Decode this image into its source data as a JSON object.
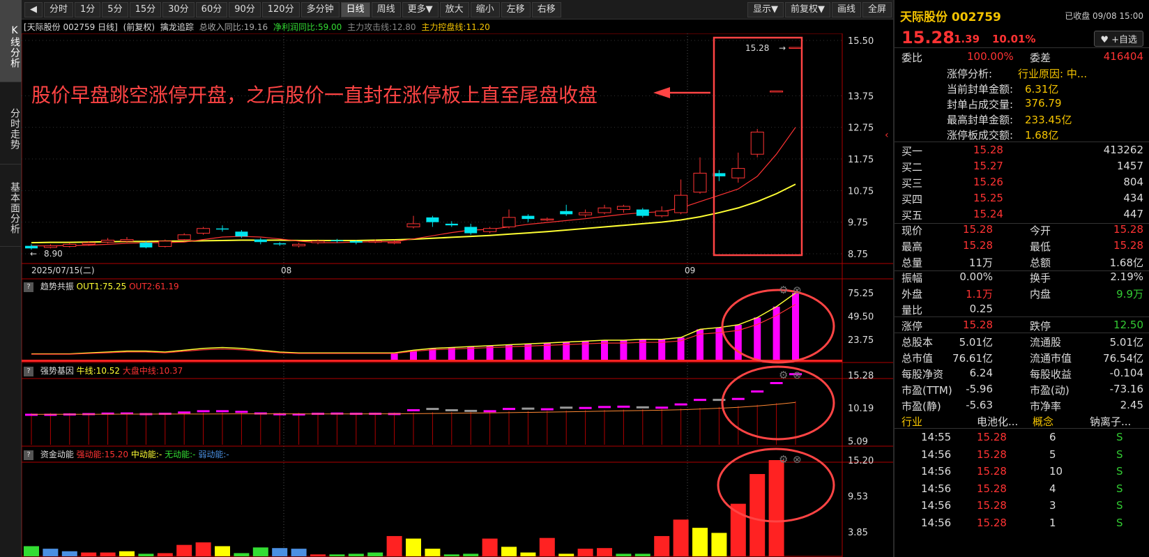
{
  "left_tabs": [
    "K线分析",
    "分时走势",
    "基本面分析"
  ],
  "toolbar": {
    "back": "◀",
    "periods": [
      "分时",
      "1分",
      "5分",
      "15分",
      "30分",
      "60分",
      "90分",
      "120分",
      "多分钟",
      "日线",
      "周线",
      "更多▼",
      "放大",
      "缩小",
      "左移",
      "右移"
    ],
    "selected": "日线",
    "right": [
      "显示▼",
      "前复权▼",
      "画线",
      "全屏"
    ]
  },
  "infobar": {
    "stock": "[天际股份 002759 日线]",
    "adj": "(前复权)",
    "indicator": "擒龙追踪",
    "rev": "总收入同比:19.16",
    "profit": "净利润同比:59.00",
    "attack": "主力攻击线:12.80",
    "control": "主力控盘线:11.20"
  },
  "colors": {
    "up": "#ff3333",
    "down": "#00e5ee",
    "ma1": "#ff3333",
    "ma2": "#ffff33",
    "magenta": "#ff00ff",
    "annotation": "#ff4444"
  },
  "annotation": "股价早盘跳空涨停开盘，之后股价一直封在涨停板上直至尾盘收盘",
  "main": {
    "price_ticks": [
      "15.50",
      "13.75",
      "12.75",
      "11.75",
      "10.75",
      "9.75",
      "8.75"
    ],
    "date_labels": [
      "2025/07/15(二)",
      "08",
      "09"
    ],
    "low_label": "8.90",
    "high_label": "15.28"
  },
  "chart_data": {
    "type": "candlestick",
    "ylim": [
      8.75,
      15.5
    ],
    "candles": [
      [
        9.0,
        8.92,
        9.05,
        8.88
      ],
      [
        8.95,
        9.0,
        9.05,
        8.92
      ],
      [
        8.98,
        9.05,
        9.1,
        8.95
      ],
      [
        9.05,
        9.1,
        9.15,
        9.0
      ],
      [
        9.12,
        9.18,
        9.25,
        9.08
      ],
      [
        9.15,
        9.2,
        9.28,
        9.1
      ],
      [
        9.1,
        8.95,
        9.15,
        8.92
      ],
      [
        8.98,
        9.15,
        9.2,
        8.95
      ],
      [
        9.2,
        9.35,
        9.4,
        9.15
      ],
      [
        9.4,
        9.55,
        9.6,
        9.35
      ],
      [
        9.55,
        9.52,
        9.65,
        9.45
      ],
      [
        9.45,
        9.3,
        9.5,
        9.25
      ],
      [
        9.2,
        9.12,
        9.25,
        9.05
      ],
      [
        9.08,
        9.05,
        9.12,
        9.0
      ],
      [
        9.0,
        9.05,
        9.1,
        8.95
      ],
      [
        9.1,
        9.15,
        9.2,
        9.05
      ],
      [
        9.18,
        9.15,
        9.22,
        9.1
      ],
      [
        9.15,
        9.1,
        9.18,
        9.05
      ],
      [
        9.12,
        9.15,
        9.2,
        9.08
      ],
      [
        9.1,
        9.12,
        9.18,
        9.05
      ],
      [
        9.6,
        9.7,
        9.95,
        9.55
      ],
      [
        9.9,
        9.75,
        9.95,
        9.6
      ],
      [
        9.7,
        9.65,
        9.78,
        9.6
      ],
      [
        9.6,
        9.4,
        9.7,
        9.35
      ],
      [
        9.45,
        9.55,
        9.6,
        9.4
      ],
      [
        9.6,
        9.9,
        10.15,
        9.55
      ],
      [
        9.95,
        9.85,
        10.0,
        9.75
      ],
      [
        9.82,
        9.85,
        9.9,
        9.78
      ],
      [
        10.1,
        10.0,
        10.3,
        9.95
      ],
      [
        9.98,
        10.05,
        10.15,
        9.9
      ],
      [
        10.05,
        10.2,
        10.3,
        10.0
      ],
      [
        10.15,
        10.25,
        10.3,
        10.05
      ],
      [
        10.15,
        9.95,
        10.2,
        9.9
      ],
      [
        9.95,
        10.1,
        10.25,
        9.9
      ],
      [
        10.05,
        10.6,
        11.1,
        10.0
      ],
      [
        10.7,
        11.3,
        11.8,
        10.65
      ],
      [
        11.3,
        11.2,
        11.4,
        11.05
      ],
      [
        11.15,
        11.45,
        11.95,
        11.0
      ],
      [
        11.9,
        12.6,
        12.7,
        11.8
      ],
      [
        13.9,
        13.9,
        13.9,
        13.9
      ],
      [
        15.28,
        15.28,
        15.28,
        15.28
      ]
    ],
    "ma_short": [
      9.0,
      9.0,
      9.01,
      9.02,
      9.05,
      9.08,
      9.1,
      9.1,
      9.12,
      9.2,
      9.28,
      9.3,
      9.28,
      9.22,
      9.15,
      9.1,
      9.1,
      9.12,
      9.13,
      9.13,
      9.22,
      9.32,
      9.42,
      9.5,
      9.52,
      9.6,
      9.68,
      9.74,
      9.8,
      9.86,
      9.93,
      10.0,
      10.05,
      10.08,
      10.2,
      10.4,
      10.6,
      10.8,
      11.2,
      11.9,
      12.75
    ],
    "ma_long": [
      9.1,
      9.11,
      9.11,
      9.12,
      9.13,
      9.14,
      9.14,
      9.15,
      9.15,
      9.16,
      9.17,
      9.18,
      9.18,
      9.18,
      9.17,
      9.17,
      9.17,
      9.17,
      9.18,
      9.19,
      9.21,
      9.24,
      9.27,
      9.3,
      9.33,
      9.37,
      9.41,
      9.45,
      9.5,
      9.55,
      9.6,
      9.65,
      9.7,
      9.75,
      9.82,
      9.92,
      10.05,
      10.2,
      10.4,
      10.65,
      10.95
    ]
  },
  "panel1": {
    "label": "趋势共振",
    "out1": "OUT1:75.25",
    "out2": "OUT2:61.19",
    "ticks": [
      "75.25",
      "49.50",
      "23.75"
    ],
    "values": [
      8,
      8,
      8,
      9,
      10,
      11,
      11,
      10,
      12,
      14,
      15,
      14,
      12,
      10,
      9,
      9,
      9,
      9,
      9,
      9,
      12,
      14,
      15,
      16,
      17,
      18,
      19,
      20,
      21,
      22,
      23,
      23,
      24,
      24,
      26,
      35,
      37,
      40,
      48,
      60,
      75
    ]
  },
  "panel2": {
    "label": "强势基因",
    "bull": "牛线:10.52",
    "mid": "大盘中线:10.37",
    "ticks": [
      "15.28",
      "10.19",
      "5.09"
    ]
  },
  "panel3": {
    "label": "资金动能",
    "strong": "强动能:15.20",
    "medium": "中动能:-",
    "none": "无动能:-",
    "weak": "弱动能:-",
    "ticks": [
      "15.20",
      "9.53",
      "3.85"
    ],
    "bars": [
      [
        1.6,
        "#33dd33"
      ],
      [
        1.2,
        "#4a90e2"
      ],
      [
        0.8,
        "#4a90e2"
      ],
      [
        0.6,
        "#ff2222"
      ],
      [
        0.6,
        "#ff2222"
      ],
      [
        0.8,
        "#ffff00"
      ],
      [
        0.4,
        "#33dd33"
      ],
      [
        0.5,
        "#ff2222"
      ],
      [
        1.8,
        "#ff2222"
      ],
      [
        2.2,
        "#ff2222"
      ],
      [
        1.6,
        "#ffff00"
      ],
      [
        0.5,
        "#33dd33"
      ],
      [
        1.4,
        "#33dd33"
      ],
      [
        1.3,
        "#4a90e2"
      ],
      [
        1.2,
        "#4a90e2"
      ],
      [
        0.3,
        "#ff2222"
      ],
      [
        0.3,
        "#33dd33"
      ],
      [
        0.4,
        "#33dd33"
      ],
      [
        0.6,
        "#33dd33"
      ],
      [
        3.2,
        "#ff2222"
      ],
      [
        2.8,
        "#ffff00"
      ],
      [
        1.2,
        "#ffff00"
      ],
      [
        0.3,
        "#33dd33"
      ],
      [
        0.4,
        "#33dd33"
      ],
      [
        2.8,
        "#ff2222"
      ],
      [
        1.5,
        "#ffff00"
      ],
      [
        0.6,
        "#ffff00"
      ],
      [
        2.9,
        "#ff2222"
      ],
      [
        0.4,
        "#ffff00"
      ],
      [
        1.2,
        "#ff2222"
      ],
      [
        1.3,
        "#ff2222"
      ],
      [
        0.4,
        "#33dd33"
      ],
      [
        0.4,
        "#33dd33"
      ],
      [
        3.2,
        "#ff2222"
      ],
      [
        5.8,
        "#ff2222"
      ],
      [
        4.5,
        "#ffff00"
      ],
      [
        3.7,
        "#ffff00"
      ],
      [
        8.3,
        "#ff2222"
      ],
      [
        13.0,
        "#ff2222"
      ],
      [
        15.2,
        "#ff2222"
      ]
    ]
  },
  "right": {
    "name": "天际股份 002759",
    "status": "已收盘 09/08 15:00",
    "price": "15.28",
    "change": "1.39",
    "pct": "10.01%",
    "fav": "♥ +自选",
    "weibi_label": "委比",
    "weibi": "100.00%",
    "weicha_label": "委差",
    "weicha": "416404",
    "analysis": [
      {
        "k": "涨停分析:",
        "v": "行业原因: 中..."
      },
      {
        "k": "当前封单金额:",
        "v": "6.31亿"
      },
      {
        "k": "封单占成交量:",
        "v": "376.79"
      },
      {
        "k": "最高封单金额:",
        "v": "233.45亿"
      },
      {
        "k": "涨停板成交额:",
        "v": "1.68亿"
      }
    ],
    "bids": [
      {
        "k": "买一",
        "p": "15.28",
        "v": "413262"
      },
      {
        "k": "买二",
        "p": "15.27",
        "v": "1457"
      },
      {
        "k": "买三",
        "p": "15.26",
        "v": "804"
      },
      {
        "k": "买四",
        "p": "15.25",
        "v": "434"
      },
      {
        "k": "买五",
        "p": "15.24",
        "v": "447"
      }
    ],
    "quote": [
      {
        "k1": "现价",
        "v1": "15.28",
        "c1": "red",
        "k2": "今开",
        "v2": "15.28",
        "c2": "red"
      },
      {
        "k1": "最高",
        "v1": "15.28",
        "c1": "red",
        "k2": "最低",
        "v2": "15.28",
        "c2": "red"
      },
      {
        "k1": "总量",
        "v1": "11万",
        "c1": "white",
        "k2": "总额",
        "v2": "1.68亿",
        "c2": "white"
      }
    ],
    "quote2": [
      {
        "k1": "振幅",
        "v1": "0.00%",
        "c1": "white",
        "k2": "换手",
        "v2": "2.19%",
        "c2": "white"
      },
      {
        "k1": "外盘",
        "v1": "1.1万",
        "c1": "red",
        "k2": "内盘",
        "v2": "9.9万",
        "c2": "green"
      },
      {
        "k1": "量比",
        "v1": "0.25",
        "c1": "white",
        "k2": "",
        "v2": "",
        "c2": "white"
      }
    ],
    "limit": {
      "k1": "涨停",
      "v1": "15.28",
      "k2": "跌停",
      "v2": "12.50"
    },
    "fund": [
      {
        "k1": "总股本",
        "v1": "5.01亿",
        "k2": "流通股",
        "v2": "5.01亿"
      },
      {
        "k1": "总市值",
        "v1": "76.61亿",
        "k2": "流通市值",
        "v2": "76.54亿"
      },
      {
        "k1": "每股净资",
        "v1": "6.24",
        "k2": "每股收益",
        "v2": "-0.104"
      },
      {
        "k1": "市盈(TTM)",
        "v1": "-5.96",
        "k2": "市盈(动)",
        "v2": "-73.16"
      },
      {
        "k1": "市盈(静)",
        "v1": "-5.63",
        "k2": "市净率",
        "v2": "2.45"
      }
    ],
    "industry_label": "行业",
    "industry": "电池化...",
    "concept_label": "概念",
    "concept": "钠离子...",
    "ticks": [
      {
        "t": "14:55",
        "p": "15.28",
        "v": "6",
        "s": "S"
      },
      {
        "t": "14:56",
        "p": "15.28",
        "v": "5",
        "s": "S"
      },
      {
        "t": "14:56",
        "p": "15.28",
        "v": "10",
        "s": "S"
      },
      {
        "t": "14:56",
        "p": "15.28",
        "v": "4",
        "s": "S"
      },
      {
        "t": "14:56",
        "p": "15.28",
        "v": "3",
        "s": "S"
      },
      {
        "t": "14:56",
        "p": "15.28",
        "v": "1",
        "s": "S"
      }
    ]
  }
}
